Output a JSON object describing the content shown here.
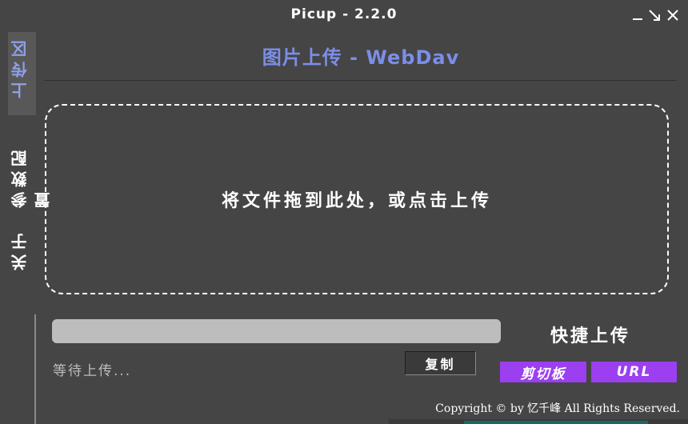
{
  "window": {
    "title": "Picup - 2.2.0"
  },
  "sidebar": {
    "items": [
      {
        "label": "上传区",
        "active": true
      },
      {
        "label": "参数配置",
        "active": false
      },
      {
        "label": "关于",
        "active": false
      }
    ]
  },
  "main": {
    "heading": "图片上传 - WebDav",
    "dropzone_text": "将文件拖到此处，或点击上传",
    "progress_percent": 0,
    "status": "等待上传...",
    "copy_label": "复制"
  },
  "quick_upload": {
    "title": "快捷上传",
    "clipboard_label": "剪切板",
    "url_label": "URL"
  },
  "footer": {
    "copyright": "Copyright © by 忆千峰 All Rights Reserved."
  },
  "colors": {
    "background": "#454545",
    "accent_blue": "#7b8ee8",
    "accent_purple": "#9b3ff0",
    "progress_track": "#bdbdbd"
  },
  "icons": [
    "minimize-icon",
    "restore-icon",
    "close-icon"
  ]
}
